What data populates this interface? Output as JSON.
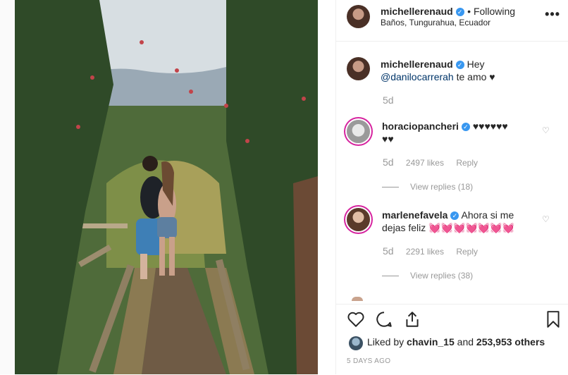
{
  "post": {
    "username": "michellerenaud",
    "follow_status": "• Following",
    "location": "Baños, Tungurahua, Ecuador",
    "more_label": "•••"
  },
  "caption": {
    "username": "michellerenaud",
    "text_hey": "Hey",
    "mention": "@danilocarrerah",
    "text_rest": "te amo ♥",
    "time": "5d"
  },
  "comments": [
    {
      "username": "horaciopancheri",
      "text_line1": "♥♥♥♥♥♥",
      "text_line2": "♥♥",
      "time": "5d",
      "likes": "2497 likes",
      "reply": "Reply",
      "view_replies": "View replies (18)"
    },
    {
      "username": "marlenefavela",
      "text_line1": "Ahora si me",
      "text_line2": "dejas feliz 💓💓💓💓💓💓💓",
      "time": "5d",
      "likes": "2291 likes",
      "reply": "Reply",
      "view_replies": "View replies (38)"
    }
  ],
  "likes": {
    "liked_by_prefix": "Liked by",
    "liked_by_user": "chavin_15",
    "and_text": "and",
    "others": "253,953 others"
  },
  "timestamp": "5 DAYS AGO",
  "icons": {
    "like": "heart-outline-icon",
    "comment": "comment-bubble-icon",
    "share": "share-icon",
    "save": "bookmark-icon",
    "comment_like": "heart-small-icon",
    "verified": "verified-badge-icon"
  },
  "colors": {
    "verified_blue": "#3897f0",
    "mention": "#003569",
    "muted": "#999999",
    "story_ring": "#d6249f"
  }
}
